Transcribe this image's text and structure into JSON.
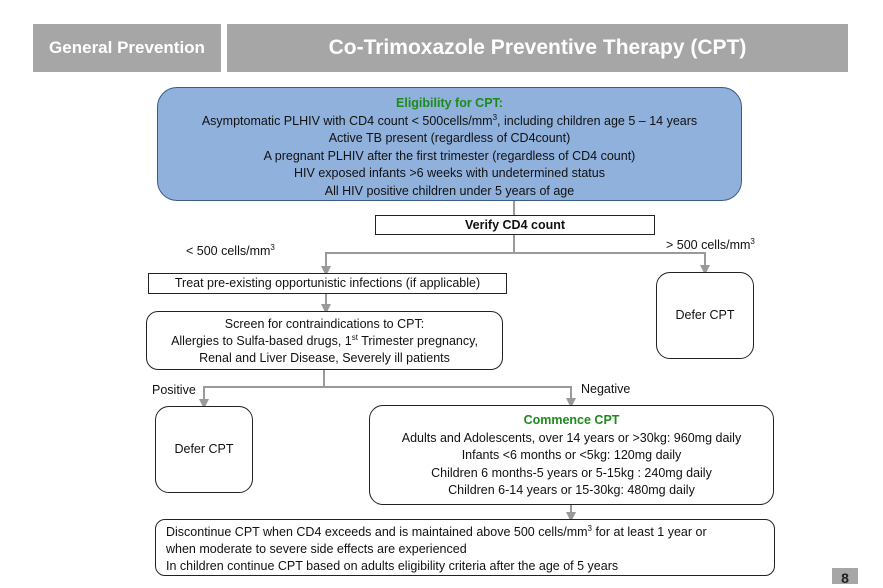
{
  "header": {
    "section": "General Prevention",
    "title": "Co-Trimoxazole Preventive Therapy (CPT)"
  },
  "eligibility": {
    "heading": "Eligibility for CPT:",
    "line1_pre": "Asymptomatic PLHIV with CD4 count < 500cells/mm",
    "line1_sup": "3",
    "line1_post": ", including children age 5 – 14 years",
    "line2": "Active TB present (regardless of CD4count)",
    "line3": "A pregnant PLHIV after the first trimester (regardless of CD4 count)",
    "line4": "HIV exposed infants >6 weeks  with undetermined status",
    "line5": "All HIV positive children under 5 years of age"
  },
  "verify": "Verify CD4 count",
  "branch_low": {
    "text": "< 500 cells/mm",
    "sup": "3"
  },
  "branch_high": {
    "text": "> 500 cells/mm",
    "sup": "3"
  },
  "treat": "Treat pre-existing opportunistic infections (if applicable)",
  "screen": {
    "line1": "Screen for contraindications to CPT:",
    "line2_pre": "Allergies to Sulfa-based drugs, 1",
    "line2_sup": "st",
    "line2_post": " Trimester pregnancy,",
    "line3": "Renal and Liver Disease, Severely ill patients"
  },
  "defer_right": "Defer CPT",
  "positive_label": "Positive",
  "negative_label": "Negative",
  "defer_left": "Defer CPT",
  "commence": {
    "heading": "Commence CPT",
    "line1": "Adults and Adolescents, over 14 years or >30kg: 960mg daily",
    "line2": "Infants <6 months or <5kg: 120mg daily",
    "line3": "Children 6 months-5 years or 5-15kg : 240mg daily",
    "line4": "Children 6-14 years or 15-30kg: 480mg daily"
  },
  "discontinue": {
    "line1_pre": "Discontinue CPT when CD4 exceeds and is maintained above 500 cells/mm",
    "line1_sup": "3",
    "line1_post": " for at least 1 year or",
    "line2": "when moderate to severe side effects are experienced",
    "line3": "In children continue CPT based on adults eligibility criteria after the age of 5 years"
  },
  "page_number": "8"
}
